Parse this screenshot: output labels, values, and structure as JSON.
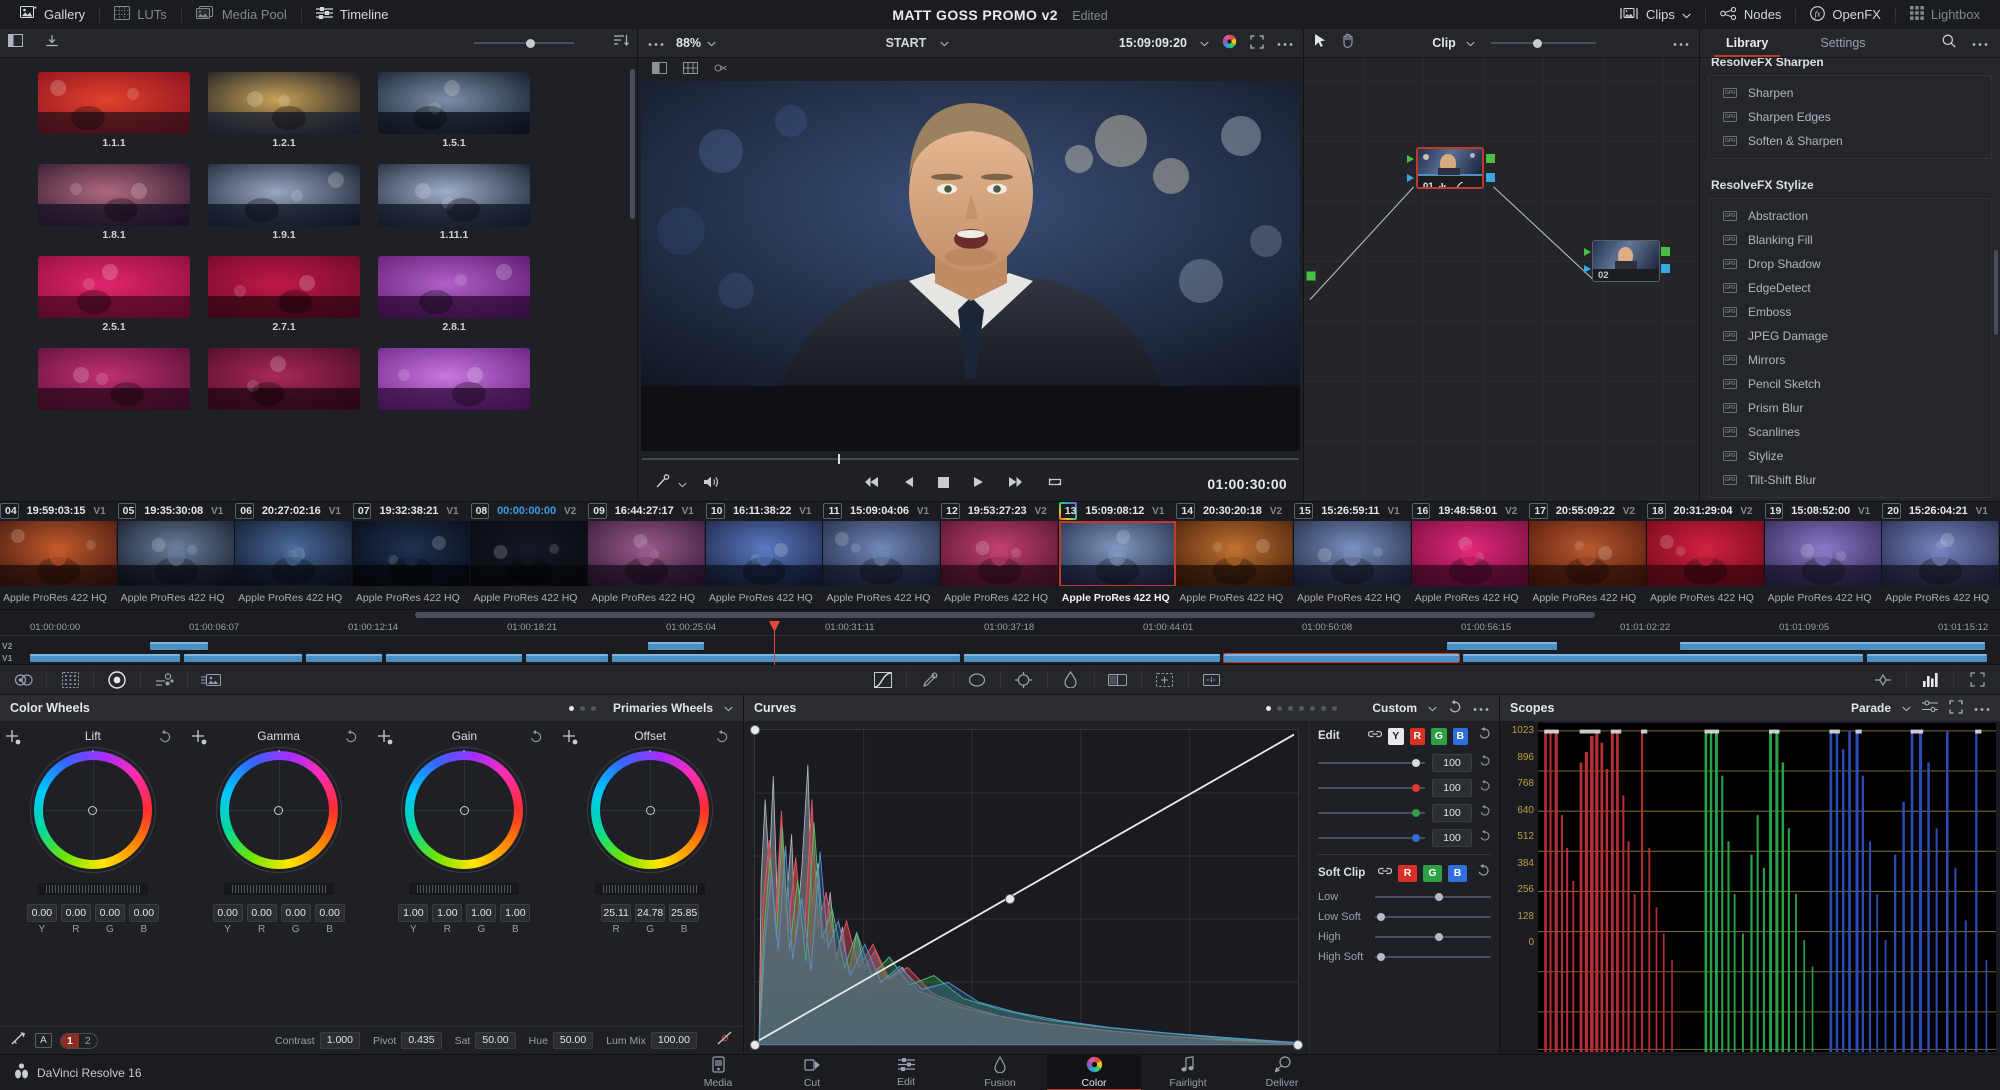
{
  "topbar": {
    "left_items": [
      {
        "label": "Gallery",
        "icon": "gallery-icon",
        "active": true
      },
      {
        "label": "LUTs",
        "icon": "luts-icon",
        "active": false
      },
      {
        "label": "Media Pool",
        "icon": "media-pool-icon",
        "active": false
      },
      {
        "label": "Timeline",
        "icon": "timeline-icon",
        "active": true
      }
    ],
    "project_title": "MATT GOSS PROMO v2",
    "project_status": "Edited",
    "right_items": [
      {
        "label": "Clips",
        "icon": "clips-icon",
        "caret": true
      },
      {
        "label": "Nodes",
        "icon": "nodes-icon",
        "caret": false
      },
      {
        "label": "OpenFX",
        "icon": "openfx-icon",
        "caret": false
      },
      {
        "label": "Lightbox",
        "icon": "lightbox-icon",
        "caret": false
      }
    ]
  },
  "gallery": {
    "toolbar_icons": [
      "panel-toggle-icon",
      "download-icon"
    ],
    "zoom_slider_value": 62,
    "sort_icon": "sort-icon",
    "stills": [
      {
        "label": "1.1.1",
        "c1": "#8b1020",
        "c2": "#e0422c",
        "c3": "#2a1018"
      },
      {
        "label": "1.2.1",
        "c1": "#0d1420",
        "c2": "#c9a257",
        "c3": "#1a2030"
      },
      {
        "label": "1.5.1",
        "c1": "#101a28",
        "c2": "#7d8fa8",
        "c3": "#0a0f18"
      },
      {
        "label": "1.8.1",
        "c1": "#2a1428",
        "c2": "#b06a80",
        "c3": "#161024"
      },
      {
        "label": "1.9.1",
        "c1": "#141c2e",
        "c2": "#9aa6c0",
        "c3": "#0d1422"
      },
      {
        "label": "1.11.1",
        "c1": "#161e30",
        "c2": "#a0aec8",
        "c3": "#0f1624"
      },
      {
        "label": "2.5.1",
        "c1": "#8e0f3c",
        "c2": "#e0256c",
        "c3": "#4a0820"
      },
      {
        "label": "2.7.1",
        "c1": "#6d0a28",
        "c2": "#c01848",
        "c3": "#2c0410"
      },
      {
        "label": "2.8.1",
        "c1": "#5e1a6e",
        "c2": "#b060c8",
        "c3": "#2a0a34"
      },
      {
        "label": "",
        "c1": "#5a1038",
        "c2": "#c03070",
        "c3": "#2a0818"
      },
      {
        "label": "",
        "c1": "#4a0c28",
        "c2": "#a82858",
        "c3": "#200610"
      },
      {
        "label": "",
        "c1": "#6a2080",
        "c2": "#c878e0",
        "c3": "#300c3c"
      }
    ]
  },
  "viewer": {
    "zoom": "88%",
    "mode": "START",
    "timecode_top": "15:09:09:20",
    "timecode_bottom": "01:00:30:00",
    "toolbar_icons": [
      "image-wipe-icon",
      "split-screen-icon",
      "cursor-select-icon"
    ],
    "sub_icons": [
      "split-icon",
      "grid-icon",
      "wipe-icon"
    ],
    "transport_icons": [
      "first-frame-icon",
      "prev-frame-icon",
      "stop-icon",
      "play-icon",
      "last-frame-icon",
      "loop-icon"
    ],
    "audio_icons": [
      "snapshot-icon",
      "speaker-icon"
    ],
    "right_icons": [
      "color-wheel-icon",
      "fullscreen-icon",
      "more-options-icon"
    ]
  },
  "nodes": {
    "mode": "Clip",
    "slider_value": 40,
    "more_icon": "more-options-icon",
    "tool_icons": [
      "cursor-select-icon",
      "hand-pan-icon"
    ],
    "node_list": [
      {
        "id": "01",
        "selected": true,
        "badges": [
          "histogram-icon",
          "curve-icon"
        ]
      },
      {
        "id": "02",
        "selected": false,
        "badges": []
      }
    ]
  },
  "fxlib": {
    "tabs": [
      {
        "label": "Library",
        "active": true
      },
      {
        "label": "Settings",
        "active": false
      }
    ],
    "icons": [
      "search-icon",
      "more-options-icon"
    ],
    "groups": [
      {
        "title": "ResolveFX Sharpen",
        "clipped": true,
        "items": [
          "Sharpen",
          "Sharpen Edges",
          "Soften & Sharpen"
        ]
      },
      {
        "title": "ResolveFX Stylize",
        "clipped": false,
        "items": [
          "Abstraction",
          "Blanking Fill",
          "Drop Shadow",
          "EdgeDetect",
          "Emboss",
          "JPEG Damage",
          "Mirrors",
          "Pencil Sketch",
          "Prism Blur",
          "Scanlines",
          "Stylize",
          "Tilt-Shift Blur"
        ]
      }
    ]
  },
  "timeline_strip": {
    "clips": [
      {
        "num": "04",
        "tc": "19:59:03:15",
        "track": "V1",
        "name": "Apple ProRes 422 HQ",
        "selected": false,
        "c1": "#3a1410",
        "c2": "#c25a2a",
        "c3": "#180808"
      },
      {
        "num": "05",
        "tc": "19:35:30:08",
        "track": "V1",
        "name": "Apple ProRes 422 HQ",
        "selected": false,
        "c1": "#0c111c",
        "c2": "#6a7e9c",
        "c3": "#06090f"
      },
      {
        "num": "06",
        "tc": "20:27:02:16",
        "track": "V1",
        "name": "Apple ProRes 422 HQ",
        "selected": false,
        "c1": "#0a1020",
        "c2": "#4a6a9a",
        "c3": "#05080f"
      },
      {
        "num": "07",
        "tc": "19:32:38:21",
        "track": "V1",
        "name": "Apple ProRes 422 HQ",
        "selected": false,
        "c1": "#060810",
        "c2": "#1e3050",
        "c3": "#030406"
      },
      {
        "num": "08",
        "tc": "00:00:00:00",
        "track": "V2",
        "name": "Apple ProRes 422 HQ",
        "selected": false,
        "tc_blue": true,
        "c1": "#0a0a0e",
        "c2": "#141824",
        "c3": "#050508"
      },
      {
        "num": "09",
        "tc": "16:44:27:17",
        "track": "V1",
        "name": "Apple ProRes 422 HQ",
        "selected": false,
        "c1": "#2a1430",
        "c2": "#9a5a8a",
        "c3": "#140a1a"
      },
      {
        "num": "10",
        "tc": "16:11:38:22",
        "track": "V1",
        "name": "Apple ProRes 422 HQ",
        "selected": false,
        "c1": "#141c38",
        "c2": "#5a78c0",
        "c3": "#0a0e1c"
      },
      {
        "num": "11",
        "tc": "15:09:04:06",
        "track": "V1",
        "name": "Apple ProRes 422 HQ",
        "selected": false,
        "c1": "#1a2038",
        "c2": "#7088b8",
        "c3": "#0d1020"
      },
      {
        "num": "12",
        "tc": "19:53:27:23",
        "track": "V2",
        "name": "Apple ProRes 422 HQ",
        "selected": false,
        "c1": "#4a1028",
        "c2": "#c04070",
        "c3": "#240814"
      },
      {
        "num": "13",
        "tc": "15:09:08:12",
        "track": "V1",
        "name": "Apple ProRes 422 HQ",
        "selected": true,
        "c1": "#182038",
        "c2": "#8098c0",
        "c3": "#0c1020"
      },
      {
        "num": "14",
        "tc": "20:30:20:18",
        "track": "V2",
        "name": "Apple ProRes 422 HQ",
        "selected": false,
        "c1": "#3a1808",
        "c2": "#c07030",
        "c3": "#1c0c04"
      },
      {
        "num": "15",
        "tc": "15:26:59:11",
        "track": "V1",
        "name": "Apple ProRes 422 HQ",
        "selected": false,
        "c1": "#1a2038",
        "c2": "#7890c0",
        "c3": "#0d1020"
      },
      {
        "num": "16",
        "tc": "19:48:58:01",
        "track": "V2",
        "name": "Apple ProRes 422 HQ",
        "selected": false,
        "c1": "#6a0c38",
        "c2": "#e02878",
        "c3": "#30051c"
      },
      {
        "num": "17",
        "tc": "20:55:09:22",
        "track": "V2",
        "name": "Apple ProRes 422 HQ",
        "selected": false,
        "c1": "#4a1408",
        "c2": "#b85830",
        "c3": "#240a04"
      },
      {
        "num": "18",
        "tc": "20:31:29:04",
        "track": "V2",
        "name": "Apple ProRes 422 HQ",
        "selected": false,
        "c1": "#6a0818",
        "c2": "#d02040",
        "c3": "#30040c"
      },
      {
        "num": "19",
        "tc": "15:08:52:00",
        "track": "V1",
        "name": "Apple ProRes 422 HQ",
        "selected": false,
        "c1": "#2a2048",
        "c2": "#8878c8",
        "c3": "#141024"
      },
      {
        "num": "20",
        "tc": "15:26:04:21",
        "track": "V1",
        "name": "Apple ProRes 422 HQ",
        "selected": false,
        "c1": "#1e2240",
        "c2": "#7884c0",
        "c3": "#0f1120"
      }
    ]
  },
  "mini_timeline": {
    "ruler_labels": [
      "01:00:00:00",
      "01:00:06:07",
      "01:00:12:14",
      "01:00:18:21",
      "01:00:25:04",
      "01:00:31:11",
      "01:00:37:18",
      "01:00:44:01",
      "01:00:50:08",
      "01:00:56:15",
      "01:01:02:22",
      "01:01:09:05",
      "01:01:15:12"
    ],
    "tracks": [
      "V2",
      "V1"
    ],
    "playhead_percent": 38.7
  },
  "lower_toolbar": {
    "left_icons": [
      "camera-raw-icon",
      "color-match-icon",
      "color-wheels-icon",
      "primaries-bars-icon",
      "log-wheels-icon"
    ],
    "center_icons": [
      "curves-icon",
      "qualifier-eyedropper-icon",
      "power-window-circle-icon",
      "tracker-icon",
      "blur-icon",
      "key-icon",
      "sizing-icon",
      "stabilizer-icon"
    ],
    "right_icons": [
      "keyframe-icon",
      "scopes-icon",
      "fullscreen-icon"
    ]
  },
  "color_wheels": {
    "panel_title": "Color Wheels",
    "mode": "Primaries Wheels",
    "page_dots": 4,
    "page_active": 0,
    "wheels": [
      {
        "name": "Lift",
        "values": [
          "0.00",
          "0.00",
          "0.00",
          "0.00"
        ],
        "labels": [
          "Y",
          "R",
          "G",
          "B"
        ]
      },
      {
        "name": "Gamma",
        "values": [
          "0.00",
          "0.00",
          "0.00",
          "0.00"
        ],
        "labels": [
          "Y",
          "R",
          "G",
          "B"
        ]
      },
      {
        "name": "Gain",
        "values": [
          "1.00",
          "1.00",
          "1.00",
          "1.00"
        ],
        "labels": [
          "Y",
          "R",
          "G",
          "B"
        ]
      },
      {
        "name": "Offset",
        "values": [
          "25.11",
          "24.78",
          "25.85"
        ],
        "labels": [
          "R",
          "G",
          "B"
        ]
      }
    ],
    "footer": {
      "auto_balance_icon": "auto-balance-icon",
      "ab_chip": "A",
      "versions": [
        "1",
        "2"
      ],
      "version_active": "1",
      "params": [
        {
          "label": "Contrast",
          "value": "1.000"
        },
        {
          "label": "Pivot",
          "value": "0.435"
        },
        {
          "label": "Sat",
          "value": "50.00"
        },
        {
          "label": "Hue",
          "value": "50.00"
        },
        {
          "label": "Lum Mix",
          "value": "100.00"
        }
      ]
    }
  },
  "curves": {
    "panel_title": "Curves",
    "mode": "Custom",
    "page_dots": 7,
    "page_active": 0,
    "reset_icon": "reset-icon",
    "more_icon": "more-options-icon",
    "edit": {
      "label": "Edit",
      "link_icon": "link-icon",
      "channels": [
        "Y",
        "R",
        "G",
        "B"
      ],
      "sliders": [
        {
          "channel": "Y",
          "value": "100",
          "color": "#d8dadd"
        },
        {
          "channel": "R",
          "value": "100",
          "color": "#e03a2f"
        },
        {
          "channel": "G",
          "value": "100",
          "color": "#2ea043"
        },
        {
          "channel": "B",
          "value": "100",
          "color": "#2f6fdb"
        }
      ]
    },
    "soft_clip": {
      "label": "Soft Clip",
      "link_icon": "link-icon",
      "channels": [
        "R",
        "G",
        "B"
      ],
      "rows": [
        {
          "label": "Low",
          "knob_percent": 52
        },
        {
          "label": "Low Soft",
          "knob_percent": 2
        },
        {
          "label": "High",
          "knob_percent": 52
        },
        {
          "label": "High Soft",
          "knob_percent": 2
        }
      ]
    }
  },
  "scopes": {
    "panel_title": "Scopes",
    "mode": "Parade",
    "icons": [
      "scope-settings-icon",
      "fullscreen-icon",
      "more-options-icon"
    ],
    "axis_labels": [
      "1023",
      "896",
      "768",
      "640",
      "512",
      "384",
      "256",
      "128",
      "0"
    ]
  },
  "bottom_nav": {
    "brand": "DaVinci Resolve 16",
    "pages": [
      {
        "label": "Media",
        "icon": "media-page-icon",
        "active": false
      },
      {
        "label": "Cut",
        "icon": "cut-page-icon",
        "active": false
      },
      {
        "label": "Edit",
        "icon": "edit-page-icon",
        "active": false
      },
      {
        "label": "Fusion",
        "icon": "fusion-page-icon",
        "active": false
      },
      {
        "label": "Color",
        "icon": "color-page-icon",
        "active": true
      },
      {
        "label": "Fairlight",
        "icon": "fairlight-page-icon",
        "active": false
      },
      {
        "label": "Deliver",
        "icon": "deliver-page-icon",
        "active": false
      }
    ]
  },
  "colors": {
    "accent_red": "#c0392b",
    "panel_bg": "#1f2026",
    "header_bg": "#25262c",
    "selected_blue": "#3d9ae0"
  }
}
